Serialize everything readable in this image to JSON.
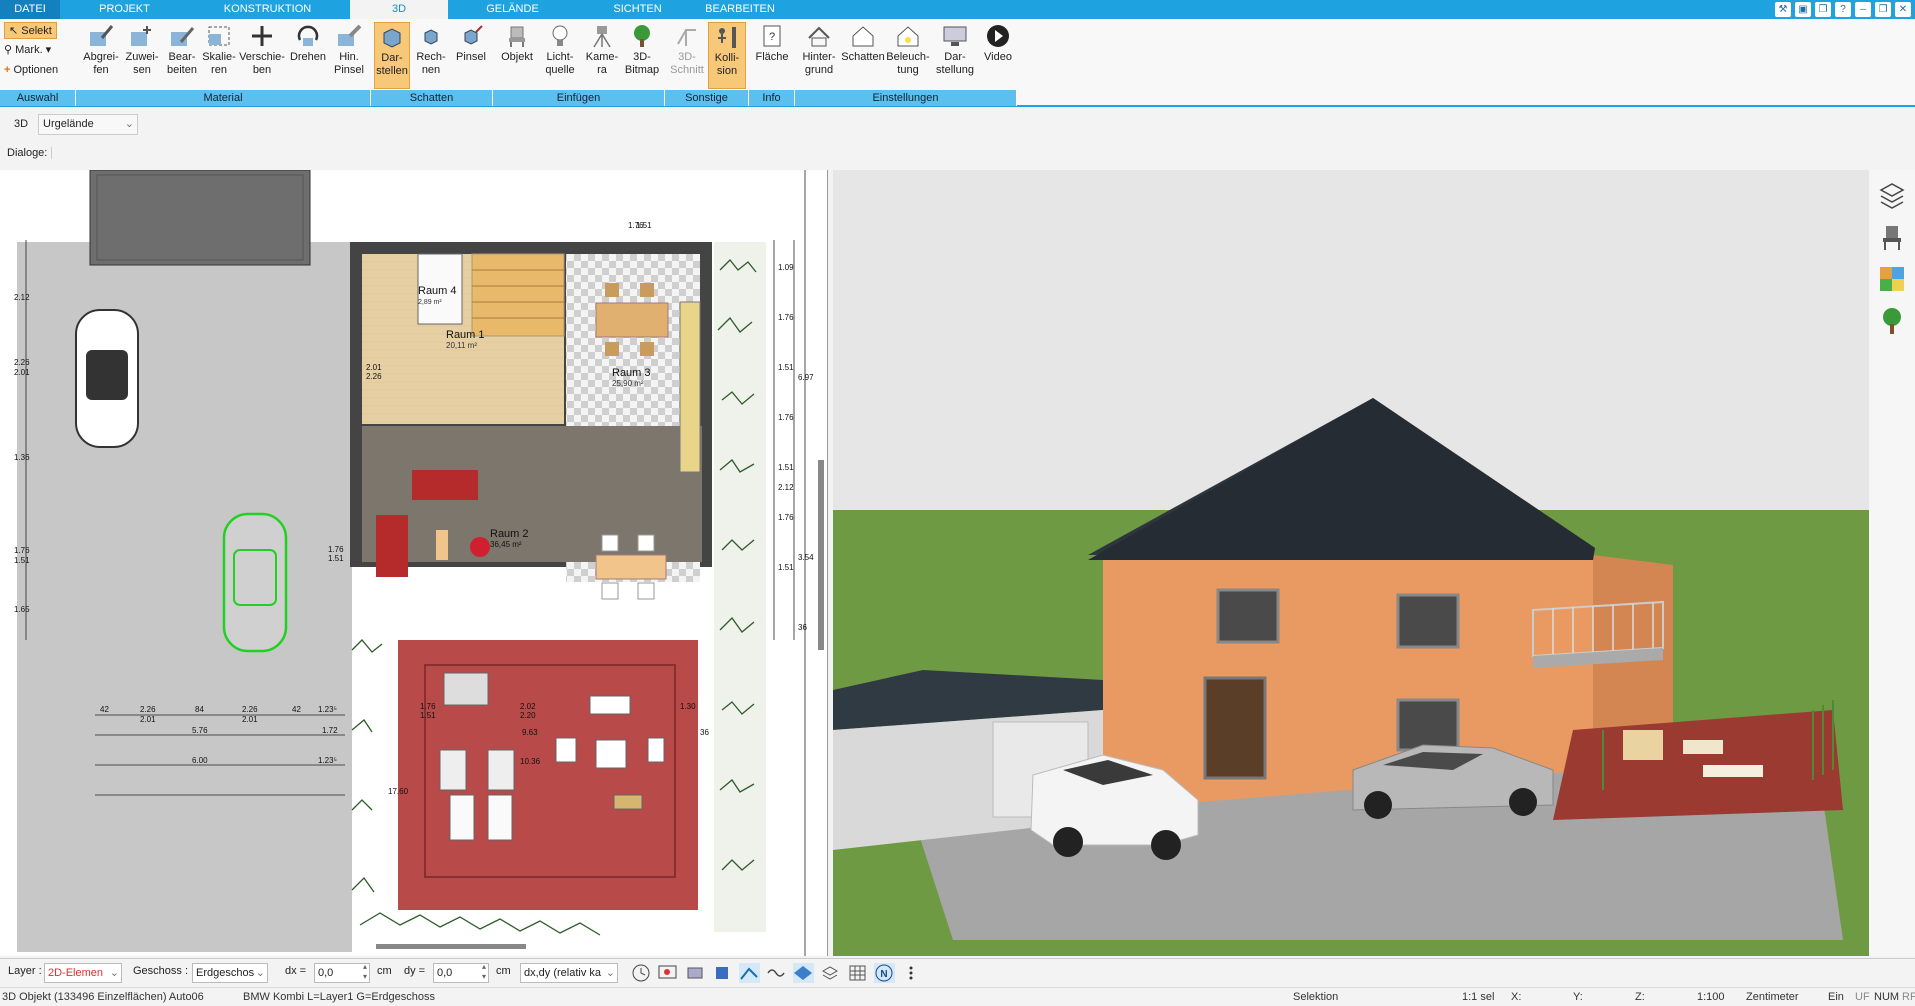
{
  "menu": {
    "tabs": [
      "DATEI",
      "PROJEKT",
      "KONSTRUKTION",
      "3D",
      "GELÄNDE",
      "SICHTEN",
      "BEARBEITEN"
    ],
    "active": "3D"
  },
  "ribbon": {
    "selekt": "Selekt",
    "mark": "Mark.",
    "optionen": "Optionen",
    "buttons": {
      "abgreifen": [
        "Abgrei-",
        "fen"
      ],
      "zuweisen": [
        "Zuwei-",
        "sen"
      ],
      "bearbeiten": [
        "Bear-",
        "beiten"
      ],
      "skalieren": [
        "Skalie-",
        "ren"
      ],
      "verschieben": [
        "Verschie-",
        "ben"
      ],
      "drehen": [
        "Drehen",
        ""
      ],
      "hinpinsel": [
        "Hin.",
        "Pinsel"
      ],
      "darstellen": [
        "Dar-",
        "stellen"
      ],
      "rechnen": [
        "Rech-",
        "nen"
      ],
      "pinsel": [
        "Pinsel",
        ""
      ],
      "objekt": [
        "Objekt",
        ""
      ],
      "lichtquelle": [
        "Licht-",
        "quelle"
      ],
      "kamera": [
        "Kame-",
        "ra"
      ],
      "bitmap": [
        "3D-",
        "Bitmap"
      ],
      "schnitt": [
        "3D-",
        "Schnitt"
      ],
      "kollision": [
        "Kolli-",
        "sion"
      ],
      "flaeche": [
        "Fläche",
        ""
      ],
      "hintergrund": [
        "Hinter-",
        "grund"
      ],
      "schatten": [
        "Schatten",
        ""
      ],
      "beleuchtung": [
        "Beleuch-",
        "tung"
      ],
      "darstellung": [
        "Dar-",
        "stellung"
      ],
      "video": [
        "Video",
        ""
      ]
    },
    "groups": {
      "auswahl": "Auswahl",
      "material": "Material",
      "schatten": "Schatten",
      "einfuegen": "Einfügen",
      "sonstige": "Sonstige",
      "info": "Info",
      "einstellungen": "Einstellungen"
    }
  },
  "viewbar": {
    "mode": "3D",
    "terrain": "Urgelände"
  },
  "dialoge": "Dialoge:",
  "plan": {
    "rooms": [
      {
        "name": "Raum 4",
        "area": "2,89 m²"
      },
      {
        "name": "Raum 1",
        "area": "20,11 m²"
      },
      {
        "name": "Raum 3",
        "area": "25,90 m²"
      },
      {
        "name": "Raum 2",
        "area": "36,45 m²"
      }
    ],
    "dims_top": [
      "42",
      "2.26",
      "84",
      "2.26",
      "42",
      "1.23⁵"
    ],
    "dims_top2": [
      "2.01",
      "2.01"
    ],
    "dims_mid": [
      "5.76",
      "1.72"
    ],
    "dims_bottom": [
      "6.00",
      "1.23⁵"
    ],
    "dims_right": [
      "1.09",
      "1.76",
      "1.51",
      "1.76",
      "1.51",
      "1.76",
      "1.51",
      "6.97",
      "3.54",
      "2.12",
      "36"
    ],
    "dims_left": [
      "2.12",
      "2.26",
      "2.01",
      "1.36",
      "1.76",
      "1.51",
      "1.65"
    ],
    "dims_terrace": [
      "1.76",
      "1.51",
      "2.02",
      "2.20",
      "1.30",
      "9.63",
      "10.36",
      "17.60",
      "36"
    ],
    "dims_stair": "1.76",
    "dims_stair2": "1.51",
    "door_a": "2.01",
    "door_b": "2.26",
    "door_c": "1.76",
    "door_d": "1.51"
  },
  "bottombar": {
    "layer_label": "Layer :",
    "layer_value": "2D-Elemen",
    "geschoss_label": "Geschoss :",
    "geschoss_value": "Erdgeschos",
    "dx_label": "dx =",
    "dx_value": "0,0",
    "dy_label": "dy =",
    "dy_value": "0,0",
    "unit": "cm",
    "mode_value": "dx,dy (relativ ka"
  },
  "status": {
    "object": "3D Objekt (133496 Einzelflächen) Auto06",
    "info": "BMW Kombi L=Layer1 G=Erdgeschoss",
    "selektion": "Selektion",
    "sel": "1:1 sel",
    "x": "X:",
    "y": "Y:",
    "z": "Z:",
    "scale": "1:100",
    "unit": "Zentimeter",
    "ein": "Ein",
    "uf": "UF",
    "num": "NUM",
    "rf": "RF"
  },
  "colors": {
    "accent": "#1fa3e0",
    "ribbon_group": "#5cc0ee",
    "active_button": "#f7c878",
    "roof": "#2d353d",
    "wall": "#e89a62",
    "grass": "#6f9a44",
    "layer_red": "#e03030"
  }
}
